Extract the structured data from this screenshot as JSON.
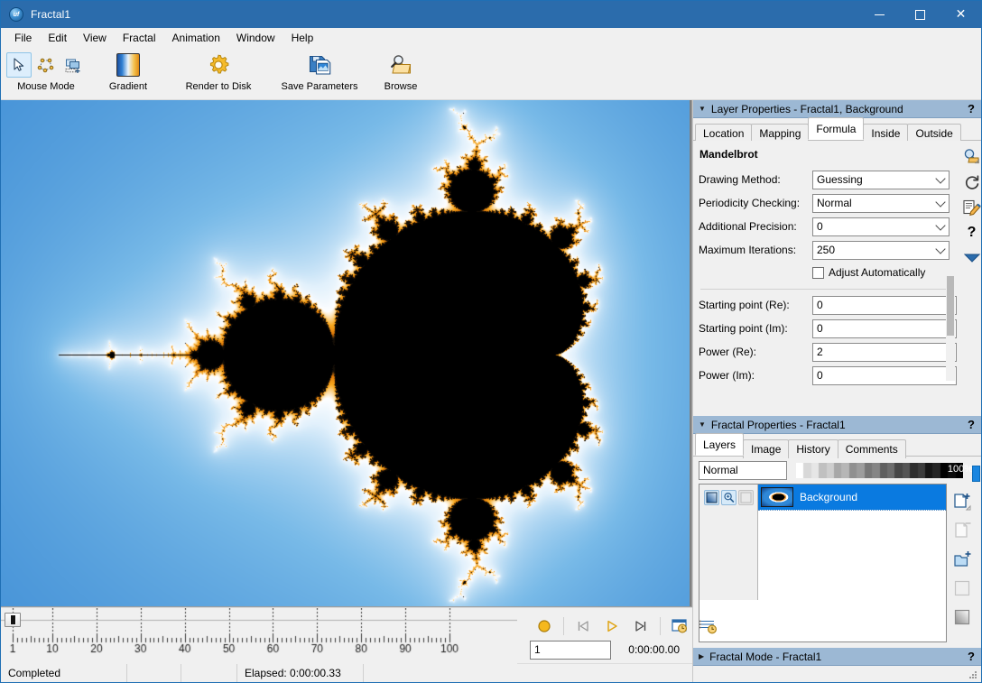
{
  "window": {
    "title": "Fractal1",
    "app_icon": "ultrafractal-globe-icon",
    "minimize": "minimize-button",
    "maximize": "maximize-button",
    "close": "close-button"
  },
  "menu": {
    "items": [
      "File",
      "Edit",
      "View",
      "Fractal",
      "Animation",
      "Window",
      "Help"
    ]
  },
  "toolbar": {
    "groups": [
      {
        "label": "Mouse Mode",
        "icons": [
          "cursor-arrow-icon",
          "select-points-icon",
          "add-layer-stack-icon"
        ]
      },
      {
        "label": "Gradient",
        "icons": [
          "gradient-swatch-icon"
        ]
      },
      {
        "label": "Render to Disk",
        "icons": [
          "gear-icon"
        ]
      },
      {
        "label": "Save Parameters",
        "icons": [
          "floppy-save-icon"
        ]
      },
      {
        "label": "Browse",
        "icons": [
          "magnifier-folder-icon"
        ]
      }
    ]
  },
  "layer_properties": {
    "header": "Layer Properties - Fractal1, Background",
    "help": "?",
    "tabs": [
      {
        "label": "Location",
        "active": false
      },
      {
        "label": "Mapping",
        "active": false
      },
      {
        "label": "Formula",
        "active": true
      },
      {
        "label": "Inside",
        "active": false
      },
      {
        "label": "Outside",
        "active": false
      }
    ],
    "formula_name": "Mandelbrot",
    "fields": [
      {
        "label": "Drawing Method:",
        "value": "Guessing",
        "type": "combo"
      },
      {
        "label": "Periodicity Checking:",
        "value": "Normal",
        "type": "combo"
      },
      {
        "label": "Additional Precision:",
        "value": "0",
        "type": "combo"
      },
      {
        "label": "Maximum Iterations:",
        "value": "250",
        "type": "combo"
      }
    ],
    "checkbox": {
      "label": "Adjust Automatically",
      "checked": false
    },
    "params": [
      {
        "label": "Starting point (Re):",
        "value": "0"
      },
      {
        "label": "Starting point (Im):",
        "value": "0"
      },
      {
        "label": "Power (Re):",
        "value": "2"
      },
      {
        "label": "Power (Im):",
        "value": "0"
      }
    ],
    "side_icons": [
      "browse-formula-icon",
      "reload-icon",
      "edit-formula-icon",
      "help-icon",
      "show-more-icon"
    ]
  },
  "fractal_properties": {
    "header": "Fractal Properties - Fractal1",
    "help": "?",
    "tabs": [
      {
        "label": "Layers",
        "active": true
      },
      {
        "label": "Image",
        "active": false
      },
      {
        "label": "History",
        "active": false
      },
      {
        "label": "Comments",
        "active": false
      }
    ],
    "blend_mode": "Normal",
    "opacity": "100%",
    "layers": [
      {
        "name": "Background",
        "selected": true,
        "toggles": [
          "visible-toggle",
          "editable-toggle",
          "mask-toggle"
        ],
        "thumbnail": "layer-thumbnail"
      }
    ],
    "side_icons": [
      "add-layer-icon",
      "delete-layer-icon",
      "add-layer-group-icon",
      "add-mask-icon",
      "gradient-layer-icon"
    ]
  },
  "fractal_mode": {
    "header": "Fractal Mode - Fractal1",
    "help": "?"
  },
  "timeline": {
    "ruler_min": 1,
    "ruler_max": 100,
    "major_ticks": [
      1,
      10,
      20,
      30,
      40,
      50,
      60,
      70,
      80,
      90,
      100
    ],
    "frame_value": "1",
    "time_readout": "0:00:00.00",
    "transport_buttons": [
      "record-button",
      "previous-key-button",
      "play-button",
      "next-key-button",
      "timeline-settings-button",
      "animation-options-button"
    ]
  },
  "status_bar": {
    "cells": [
      "Completed",
      "",
      "",
      "Elapsed: 0:00:00.33",
      ""
    ]
  },
  "image": {
    "name": "mandelbrot-fractal-canvas",
    "colors": {
      "background_deep_blue": "#1455b4",
      "background_light_blue": "#4e9fe0",
      "near_white": "#eaf4fd",
      "orange": "#f5a01e",
      "set_black": "#000000"
    }
  },
  "theme": {
    "title_bar": "#2b6cac",
    "panel_header": "#9cb8d4",
    "selection_blue": "#0a7ae0",
    "toolbar_bg": "#f0f0f0"
  }
}
